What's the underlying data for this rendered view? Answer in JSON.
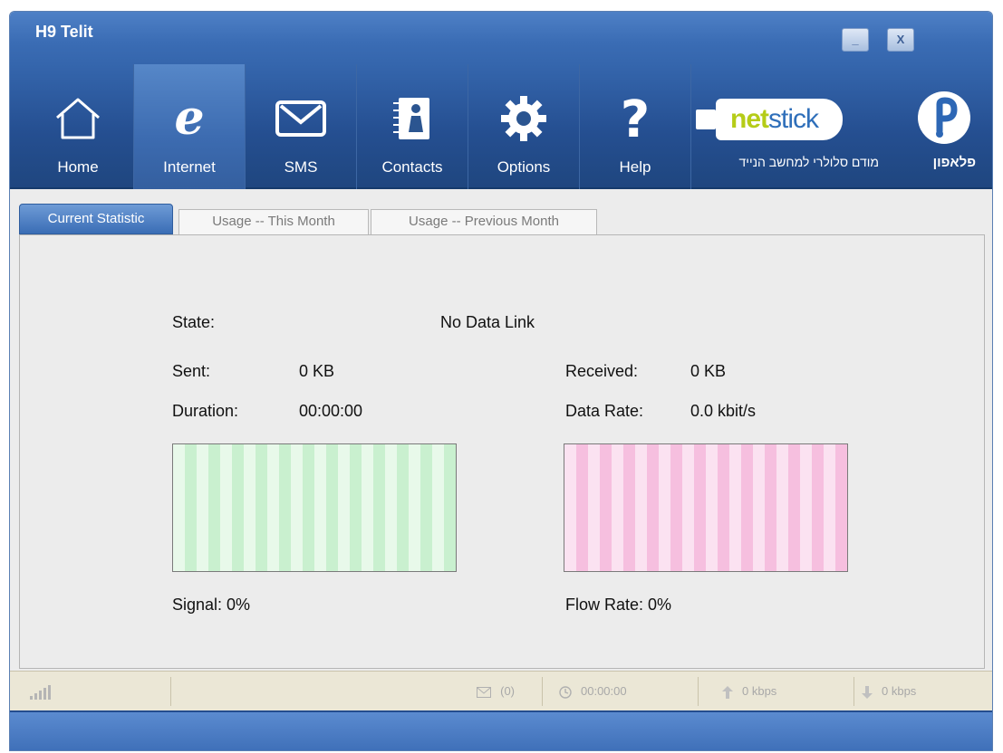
{
  "window": {
    "title": "H9 Telit"
  },
  "controls": {
    "minimize": "_",
    "close": "X"
  },
  "toolbar": {
    "items": [
      {
        "label": "Home",
        "icon": "house-icon"
      },
      {
        "label": "Internet",
        "icon": "internet-e-icon",
        "active": true
      },
      {
        "label": "SMS",
        "icon": "envelope-icon"
      },
      {
        "label": "Contacts",
        "icon": "address-book-icon"
      },
      {
        "label": "Options",
        "icon": "gear-icon"
      },
      {
        "label": "Help",
        "icon": "question-mark-icon"
      }
    ]
  },
  "brand": {
    "netstick_net": "net",
    "netstick_stick": "stick",
    "tagline": "מודם סלולרי למחשב הנייד",
    "pelephone": "פלאפון"
  },
  "tabs": [
    {
      "label": "Current Statistic",
      "active": true
    },
    {
      "label": "Usage -- This Month"
    },
    {
      "label": "Usage -- Previous Month"
    }
  ],
  "stats": {
    "state_label": "State:",
    "state_value": "No Data Link",
    "sent_label": "Sent:",
    "sent_value": "0 KB",
    "received_label": "Received:",
    "received_value": "0 KB",
    "duration_label": "Duration:",
    "duration_value": "00:00:00",
    "data_rate_label": "Data Rate:",
    "data_rate_value": "0.0 kbit/s",
    "signal_text": "Signal: 0%",
    "flow_rate_text": "Flow Rate: 0%",
    "signal_level": 0,
    "flow_rate_level": 0
  },
  "statusbar": {
    "sms_count": "(0)",
    "connection_time": "00:00:00",
    "upload_rate": "0 kbps",
    "download_rate": "0 kbps"
  },
  "colors": {
    "accent": "#3a6cb4",
    "signal_graph": "#c9f0cf",
    "flow_graph": "#f6bfdf"
  }
}
